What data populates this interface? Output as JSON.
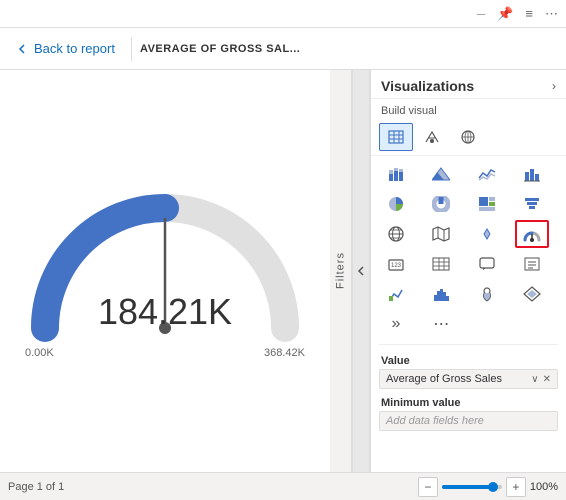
{
  "topbar": {
    "icons": [
      "─",
      "📌",
      "≡",
      "⋯"
    ]
  },
  "navbar": {
    "back_label": "Back to report",
    "page_title": "AVERAGE OF GROSS SAL..."
  },
  "gauge": {
    "value": "184.21K",
    "min_label": "0.00K",
    "max_label": "368.42K",
    "needle_angle": 90,
    "fill_pct": 0.5
  },
  "filters_tab": {
    "label": "Filters"
  },
  "visualizations": {
    "title": "Visualizations",
    "build_visual_label": "Build visual",
    "icons_row1": [
      "▦",
      "🔀",
      "📊",
      "🔵"
    ],
    "icons_row2": [
      "📈",
      "🏔",
      "〰",
      "📊",
      "🥧",
      "⋯"
    ],
    "icons_row3": [
      "▭",
      "🗃",
      "▤",
      "🕐",
      "⬤",
      "🔲"
    ],
    "icons_row4": [
      "🌐",
      "🗺",
      "▲",
      "gauge",
      "123",
      "≡"
    ],
    "icons_row5": [
      "△",
      "🔳",
      "▦",
      "▤",
      "⟦",
      "⋯"
    ],
    "icons_row6": [
      "💬",
      "📄",
      "🏆",
      "📊",
      "📍",
      "◆"
    ],
    "icons_row7": [
      "»",
      "⋯"
    ],
    "active_icon": "gauge",
    "fields": {
      "value_label": "Value",
      "value_field": "Average of Gross Sales",
      "min_label": "Minimum value",
      "min_placeholder": "Add data fields here"
    }
  },
  "bottombar": {
    "page_label": "Page 1 of 1",
    "zoom_minus": "−",
    "zoom_plus": "+",
    "zoom_pct": "100%"
  }
}
